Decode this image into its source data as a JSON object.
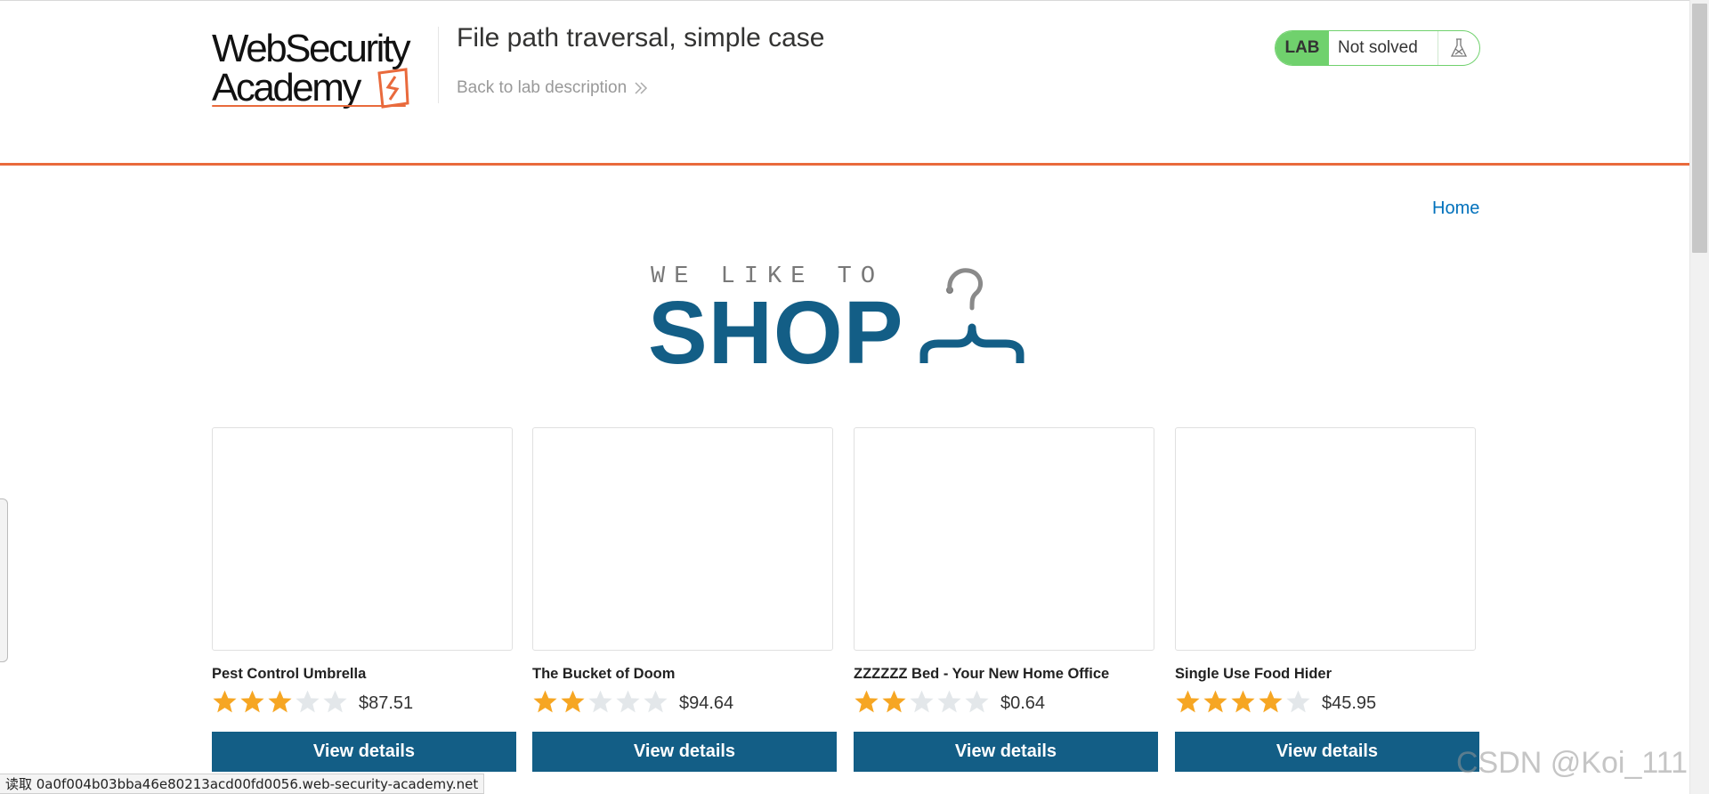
{
  "header": {
    "logo_line1": "WebSecurity",
    "logo_line2": "Academy",
    "lab_title": "File path traversal, simple case",
    "back_link": "Back to lab description",
    "lab_badge": "LAB",
    "lab_status": "Not solved"
  },
  "nav": {
    "home": "Home"
  },
  "banner": {
    "top": "WE LIKE TO",
    "main": "SHOP"
  },
  "colors": {
    "accent": "#e96a3c",
    "brand": "#135e86",
    "lab_green": "#70d16d",
    "link": "#0071bc",
    "star_on": "#f6a623",
    "star_off": "#e3e7ea"
  },
  "products": [
    {
      "name": "Pest Control Umbrella",
      "rating": 3,
      "price": "$87.51",
      "button": "View details"
    },
    {
      "name": "The Bucket of Doom",
      "rating": 2,
      "price": "$94.64",
      "button": "View details"
    },
    {
      "name": "ZZZZZZ Bed - Your New Home Office",
      "rating": 2,
      "price": "$0.64",
      "button": "View details"
    },
    {
      "name": "Single Use Food Hider",
      "rating": 4,
      "price": "$45.95",
      "button": "View details"
    }
  ],
  "statusbar": {
    "text": "读取 0a0f004b03bba46e80213acd00fd0056.web-security-academy.net"
  },
  "watermark": "CSDN @Koi_111"
}
